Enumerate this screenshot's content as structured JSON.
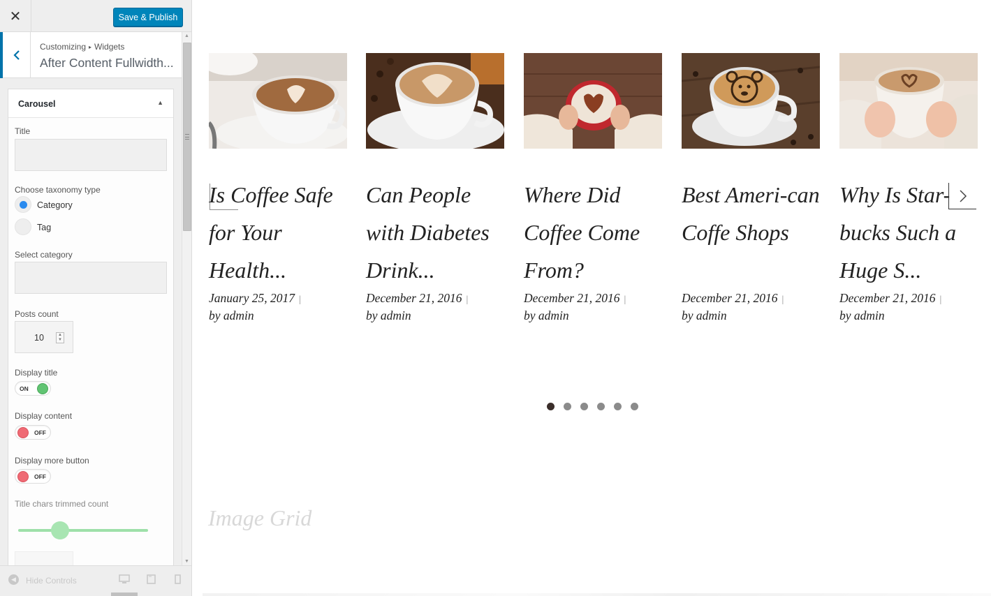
{
  "header": {
    "close_label": "✕",
    "publish_label": "Save & Publish"
  },
  "section": {
    "breadcrumb_root": "Customizing",
    "breadcrumb_child": "Widgets",
    "title": "After Content Fullwidth..."
  },
  "widget": {
    "name": "Carousel",
    "title_label": "Title",
    "title_value": "",
    "taxonomy_label": "Choose taxonomy type",
    "taxonomy_options": [
      "Category",
      "Tag"
    ],
    "taxonomy_selected": "Category",
    "category_label": "Select category",
    "category_value": "",
    "posts_count_label": "Posts count",
    "posts_count_value": "10",
    "display_title_label": "Display title",
    "display_title_state": "ON",
    "display_content_label": "Display content",
    "display_content_state": "OFF",
    "display_more_label": "Display more button",
    "display_more_state": "OFF",
    "title_trim_label": "Title chars trimmed count"
  },
  "footer": {
    "hide_controls_label": "Hide Controls",
    "devices": [
      "desktop-icon",
      "tablet-icon",
      "mobile-icon"
    ]
  },
  "preview": {
    "posts": [
      {
        "title": "Is Coffee Safe for Your Health...",
        "date": "January 25, 2017",
        "author": "by admin"
      },
      {
        "title": "Can People with Diabetes Drink...",
        "date": "December 21, 2016",
        "author": "by admin"
      },
      {
        "title": "Where Did Coffee Come From?",
        "date": "December 21, 2016",
        "author": "by admin"
      },
      {
        "title": "Best Ameri-can Coffe Shops",
        "date": "December 21, 2016",
        "author": "by admin"
      },
      {
        "title": "Why Is Star-bucks Such a Huge S...",
        "date": "December 21, 2016",
        "author": "by admin"
      }
    ],
    "carousel_pages": 6,
    "carousel_active_page": 1,
    "next_section_title": "Image Grid"
  },
  "colors": {
    "publish": "#0085ba",
    "accent": "#0073aa",
    "toggle_on": "#61c473",
    "toggle_off": "#ef6a74",
    "radio_on": "#2a8bef",
    "slider": "#9ee0a9"
  }
}
